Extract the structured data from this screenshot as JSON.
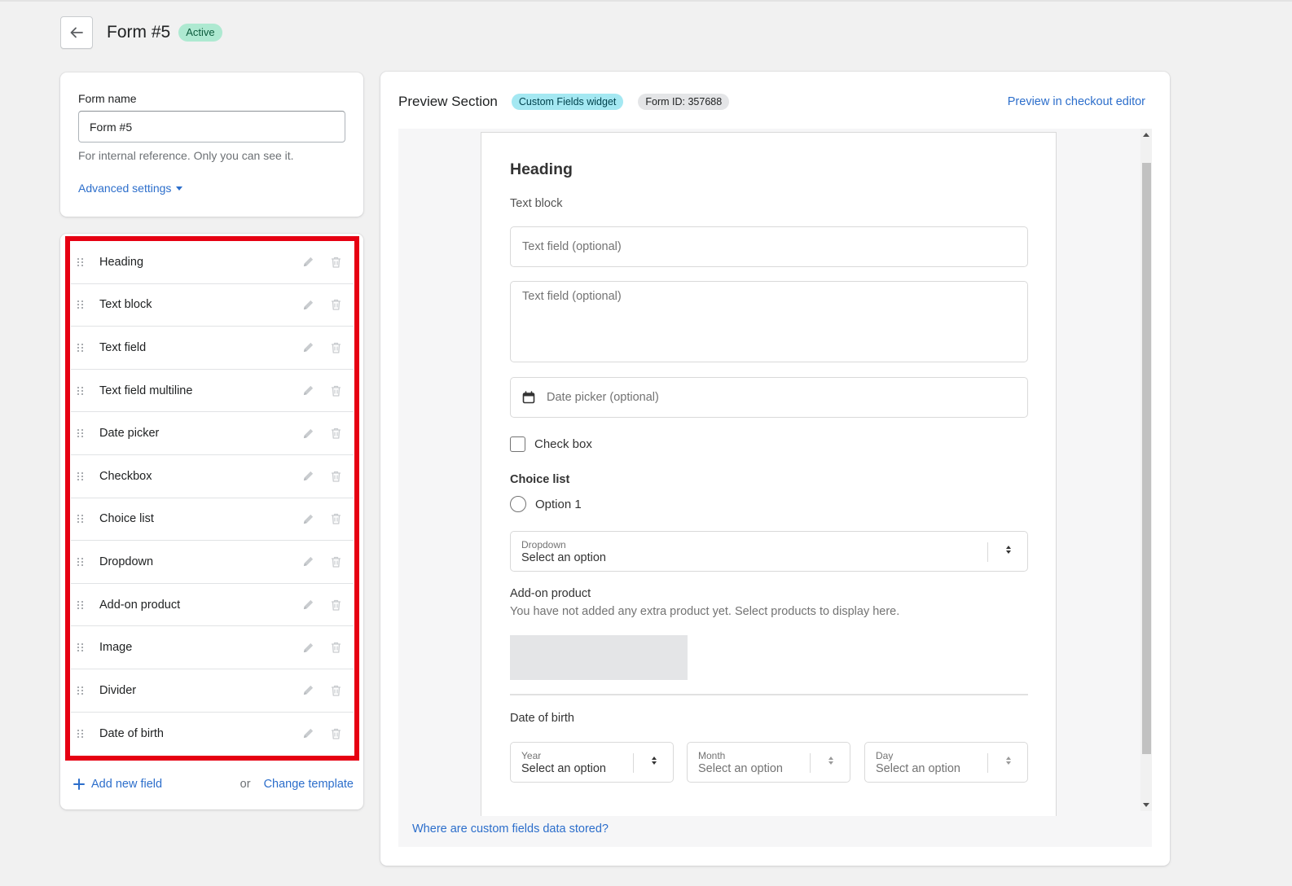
{
  "header": {
    "title": "Form #5",
    "status": "Active"
  },
  "form_name": {
    "label": "Form name",
    "value": "Form #5",
    "help": "For internal reference. Only you can see it.",
    "advanced_link": "Advanced settings"
  },
  "fields": {
    "items": [
      {
        "label": "Heading"
      },
      {
        "label": "Text block"
      },
      {
        "label": "Text field"
      },
      {
        "label": "Text field multiline"
      },
      {
        "label": "Date picker"
      },
      {
        "label": "Checkbox"
      },
      {
        "label": "Choice list"
      },
      {
        "label": "Dropdown"
      },
      {
        "label": "Add-on product"
      },
      {
        "label": "Image"
      },
      {
        "label": "Divider"
      },
      {
        "label": "Date of birth"
      }
    ],
    "add_new": "Add new field",
    "or": "or",
    "change_template": "Change template"
  },
  "preview": {
    "title": "Preview Section",
    "widget_badge": "Custom Fields widget",
    "form_id_badge": "Form ID: 357688",
    "checkout_link": "Preview in checkout editor",
    "storage_link": "Where are custom fields data stored?",
    "form": {
      "heading": "Heading",
      "text_block": "Text block",
      "text_field_placeholder": "Text field (optional)",
      "text_multiline_placeholder": "Text field (optional)",
      "date_picker_placeholder": "Date picker (optional)",
      "checkbox_label": "Check box",
      "choice_title": "Choice list",
      "choice_option": "Option 1",
      "dropdown_label": "Dropdown",
      "dropdown_value": "Select an option",
      "addon_title": "Add-on product",
      "addon_desc": "You have not added any extra product yet. Select products to display here.",
      "dob_title": "Date of birth",
      "dob_year_label": "Year",
      "dob_year_value": "Select an option",
      "dob_month_label": "Month",
      "dob_month_value": "Select an option",
      "dob_day_label": "Day",
      "dob_day_value": "Select an option"
    }
  },
  "colors": {
    "highlight_border": "#e60012",
    "link": "#2c6ecb",
    "active_badge": "#aee9d1",
    "widget_badge": "#a4e8f2"
  }
}
